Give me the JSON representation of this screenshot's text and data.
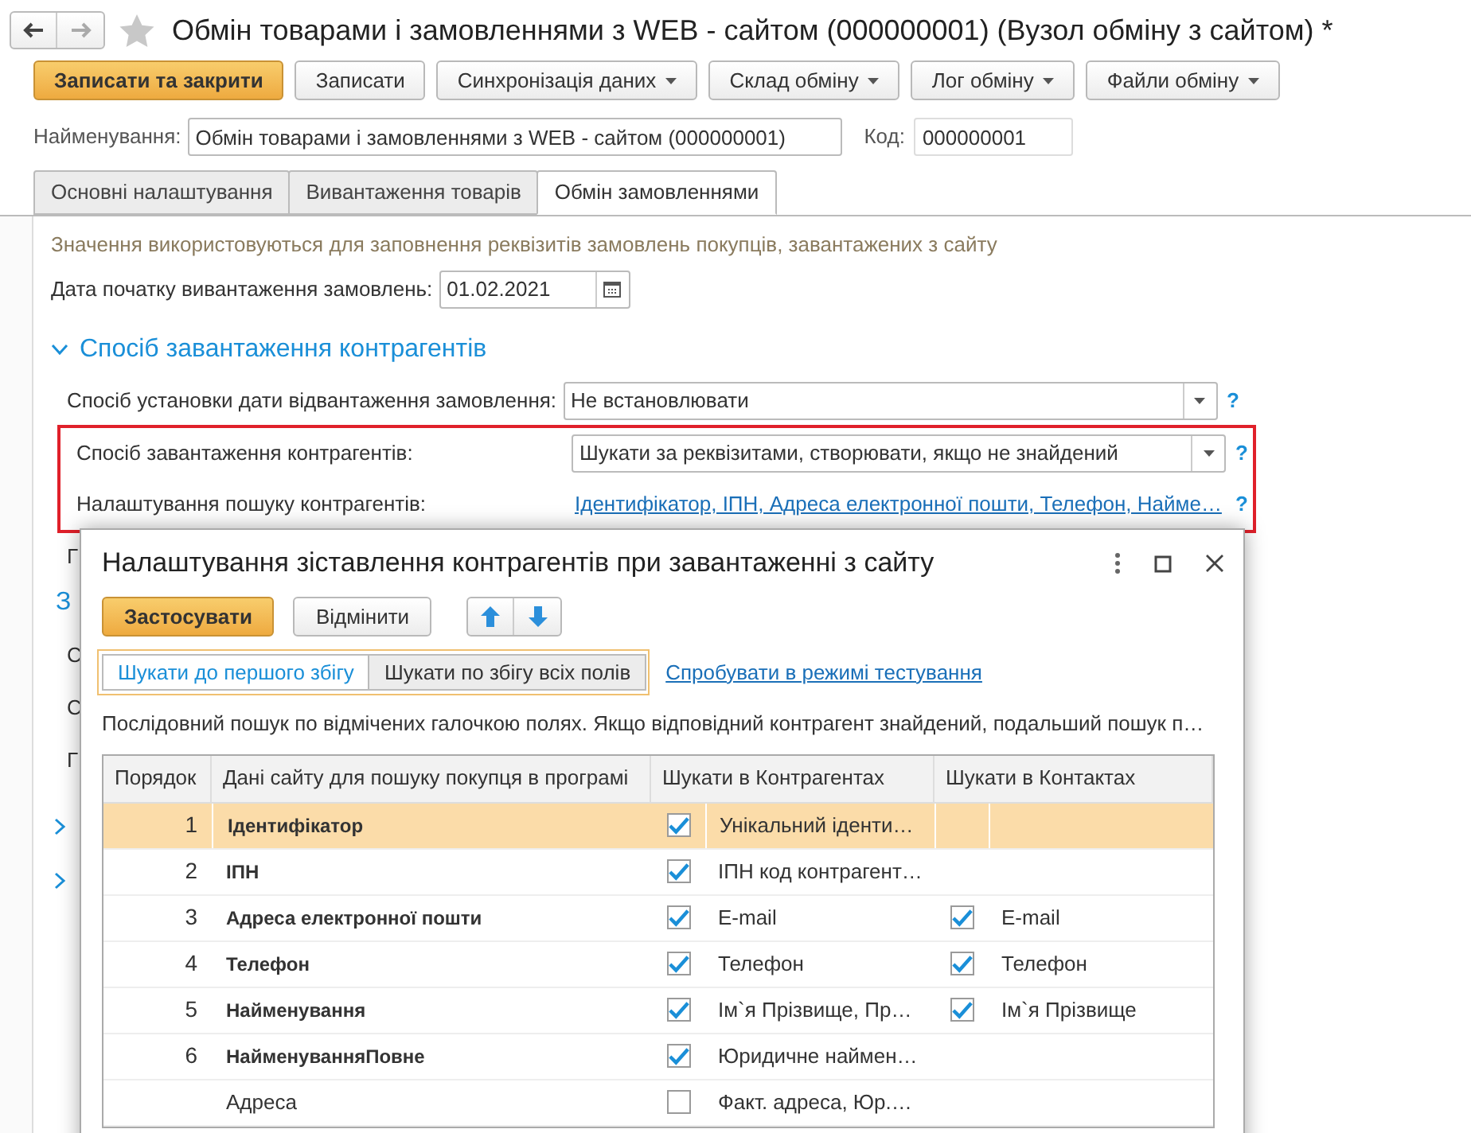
{
  "window": {
    "title": "Обмін товарами і замовленнями з WEB - сайтом (000000001) (Вузол обміну з сайтом) *"
  },
  "toolbar": [
    {
      "label": "Записати та закрити",
      "kind": "primary"
    },
    {
      "label": "Записати",
      "kind": "plain"
    },
    {
      "label": "Синхронізація даних",
      "kind": "menu"
    },
    {
      "label": "Склад обміну",
      "kind": "menu"
    },
    {
      "label": "Лог обміну",
      "kind": "menu"
    },
    {
      "label": "Файли обміну",
      "kind": "menu"
    }
  ],
  "name_field": {
    "label": "Найменування:",
    "value": "Обмін товарами і замовленнями з WEB - сайтом (000000001)"
  },
  "code_field": {
    "label": "Код:",
    "value": "000000001"
  },
  "tabs": [
    {
      "label": "Основні налаштування",
      "selected": false
    },
    {
      "label": "Вивантаження товарів",
      "selected": false
    },
    {
      "label": "Обмін замовленнями",
      "selected": true
    }
  ],
  "hint": "Значення використовуються для заповнення реквізитів замовлень покупців, завантажених з сайту",
  "date_field": {
    "label": "Дата початку вивантаження замовлень:",
    "value": "01.02.2021"
  },
  "section": {
    "title": "Спосіб завантаження контрагентів",
    "expanded": true
  },
  "settings": [
    {
      "label": "Спосіб установки дати відвантаження замовлення:",
      "kind": "select",
      "value": "Не встановлювати",
      "help": "?",
      "highlighted": false
    },
    {
      "label": "Спосіб завантаження контрагентів:",
      "kind": "select",
      "value": "Шукати за реквізитами, створювати, якщо не знайдений",
      "help": "?",
      "highlighted": true
    },
    {
      "label": "Налаштування пошуку контрагентів:",
      "kind": "link",
      "value": "Ідентифікатор, ІПН, Адреса електронної пошти, Телефон, Найме…",
      "help": "?",
      "highlighted": true
    }
  ],
  "hidden_labels": [
    {
      "text": "Г",
      "kind": "label"
    },
    {
      "text": "З",
      "kind": "section"
    },
    {
      "text": "С",
      "kind": "label"
    },
    {
      "text": "С",
      "kind": "label"
    },
    {
      "text": "Г",
      "kind": "label"
    }
  ],
  "collapsed_sections": [
    {
      "expanded": false
    },
    {
      "expanded": false
    }
  ],
  "dialog": {
    "title": "Налаштування зіставлення контрагентів при завантаженні з сайту",
    "buttons": [
      {
        "label": "Застосувати",
        "kind": "primary"
      },
      {
        "label": "Відмінити",
        "kind": "plain"
      }
    ],
    "modes": [
      {
        "label": "Шукати до першого збігу",
        "selected": true
      },
      {
        "label": "Шукати по збігу всіх полів",
        "selected": false
      }
    ],
    "test_link": "Спробувати в режимі тестування",
    "description": "Послідовний пошук по відмічених галочкою полях. Якщо відповідний контрагент знайдений, подальший пошук п…",
    "table": {
      "columns": [
        "Порядок",
        "Дані сайту для пошуку покупця в програмі",
        "Шукати в Контрагентах",
        "Шукати в Контактах"
      ],
      "rows": [
        {
          "order": "1",
          "field": "Ідентифікатор",
          "search_checked": true,
          "search_field": "Унікальний іденти…",
          "contact_checked": null,
          "contact_field": "",
          "selected": true
        },
        {
          "order": "2",
          "field": "ІПН",
          "search_checked": true,
          "search_field": "ІПН код контрагент…",
          "contact_checked": null,
          "contact_field": "",
          "selected": false
        },
        {
          "order": "3",
          "field": "Адреса електронної пошти",
          "search_checked": true,
          "search_field": "E-mail",
          "contact_checked": true,
          "contact_field": "E-mail",
          "selected": false
        },
        {
          "order": "4",
          "field": "Телефон",
          "search_checked": true,
          "search_field": "Телефон",
          "contact_checked": true,
          "contact_field": "Телефон",
          "selected": false
        },
        {
          "order": "5",
          "field": "Найменування",
          "search_checked": true,
          "search_field": "Ім`я Прізвище, Пр…",
          "contact_checked": true,
          "contact_field": "Ім`я Прізвище",
          "selected": false
        },
        {
          "order": "6",
          "field": "НайменуванняПовне",
          "search_checked": true,
          "search_field": "Юридичне наймен…",
          "contact_checked": null,
          "contact_field": "",
          "selected": false
        },
        {
          "order": "",
          "field": "Адреса",
          "search_checked": false,
          "search_field": "Факт. адреса, Юр.…",
          "contact_checked": null,
          "contact_field": "",
          "selected": false
        }
      ]
    }
  }
}
